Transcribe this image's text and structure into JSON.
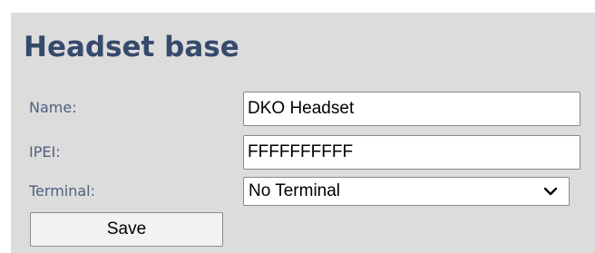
{
  "page": {
    "title": "Headset base"
  },
  "form": {
    "name_label": "Name:",
    "name_value": "DKO Headset",
    "ipei_label": "IPEI:",
    "ipei_value": "FFFFFFFFFF",
    "terminal_label": "Terminal:",
    "terminal_value": "No Terminal",
    "save_label": "Save"
  },
  "icons": {
    "dropdown": "chevron-down-icon"
  },
  "colors": {
    "panel_background": "#dcdcdc",
    "title": "#364a6c",
    "label": "#50607e"
  }
}
